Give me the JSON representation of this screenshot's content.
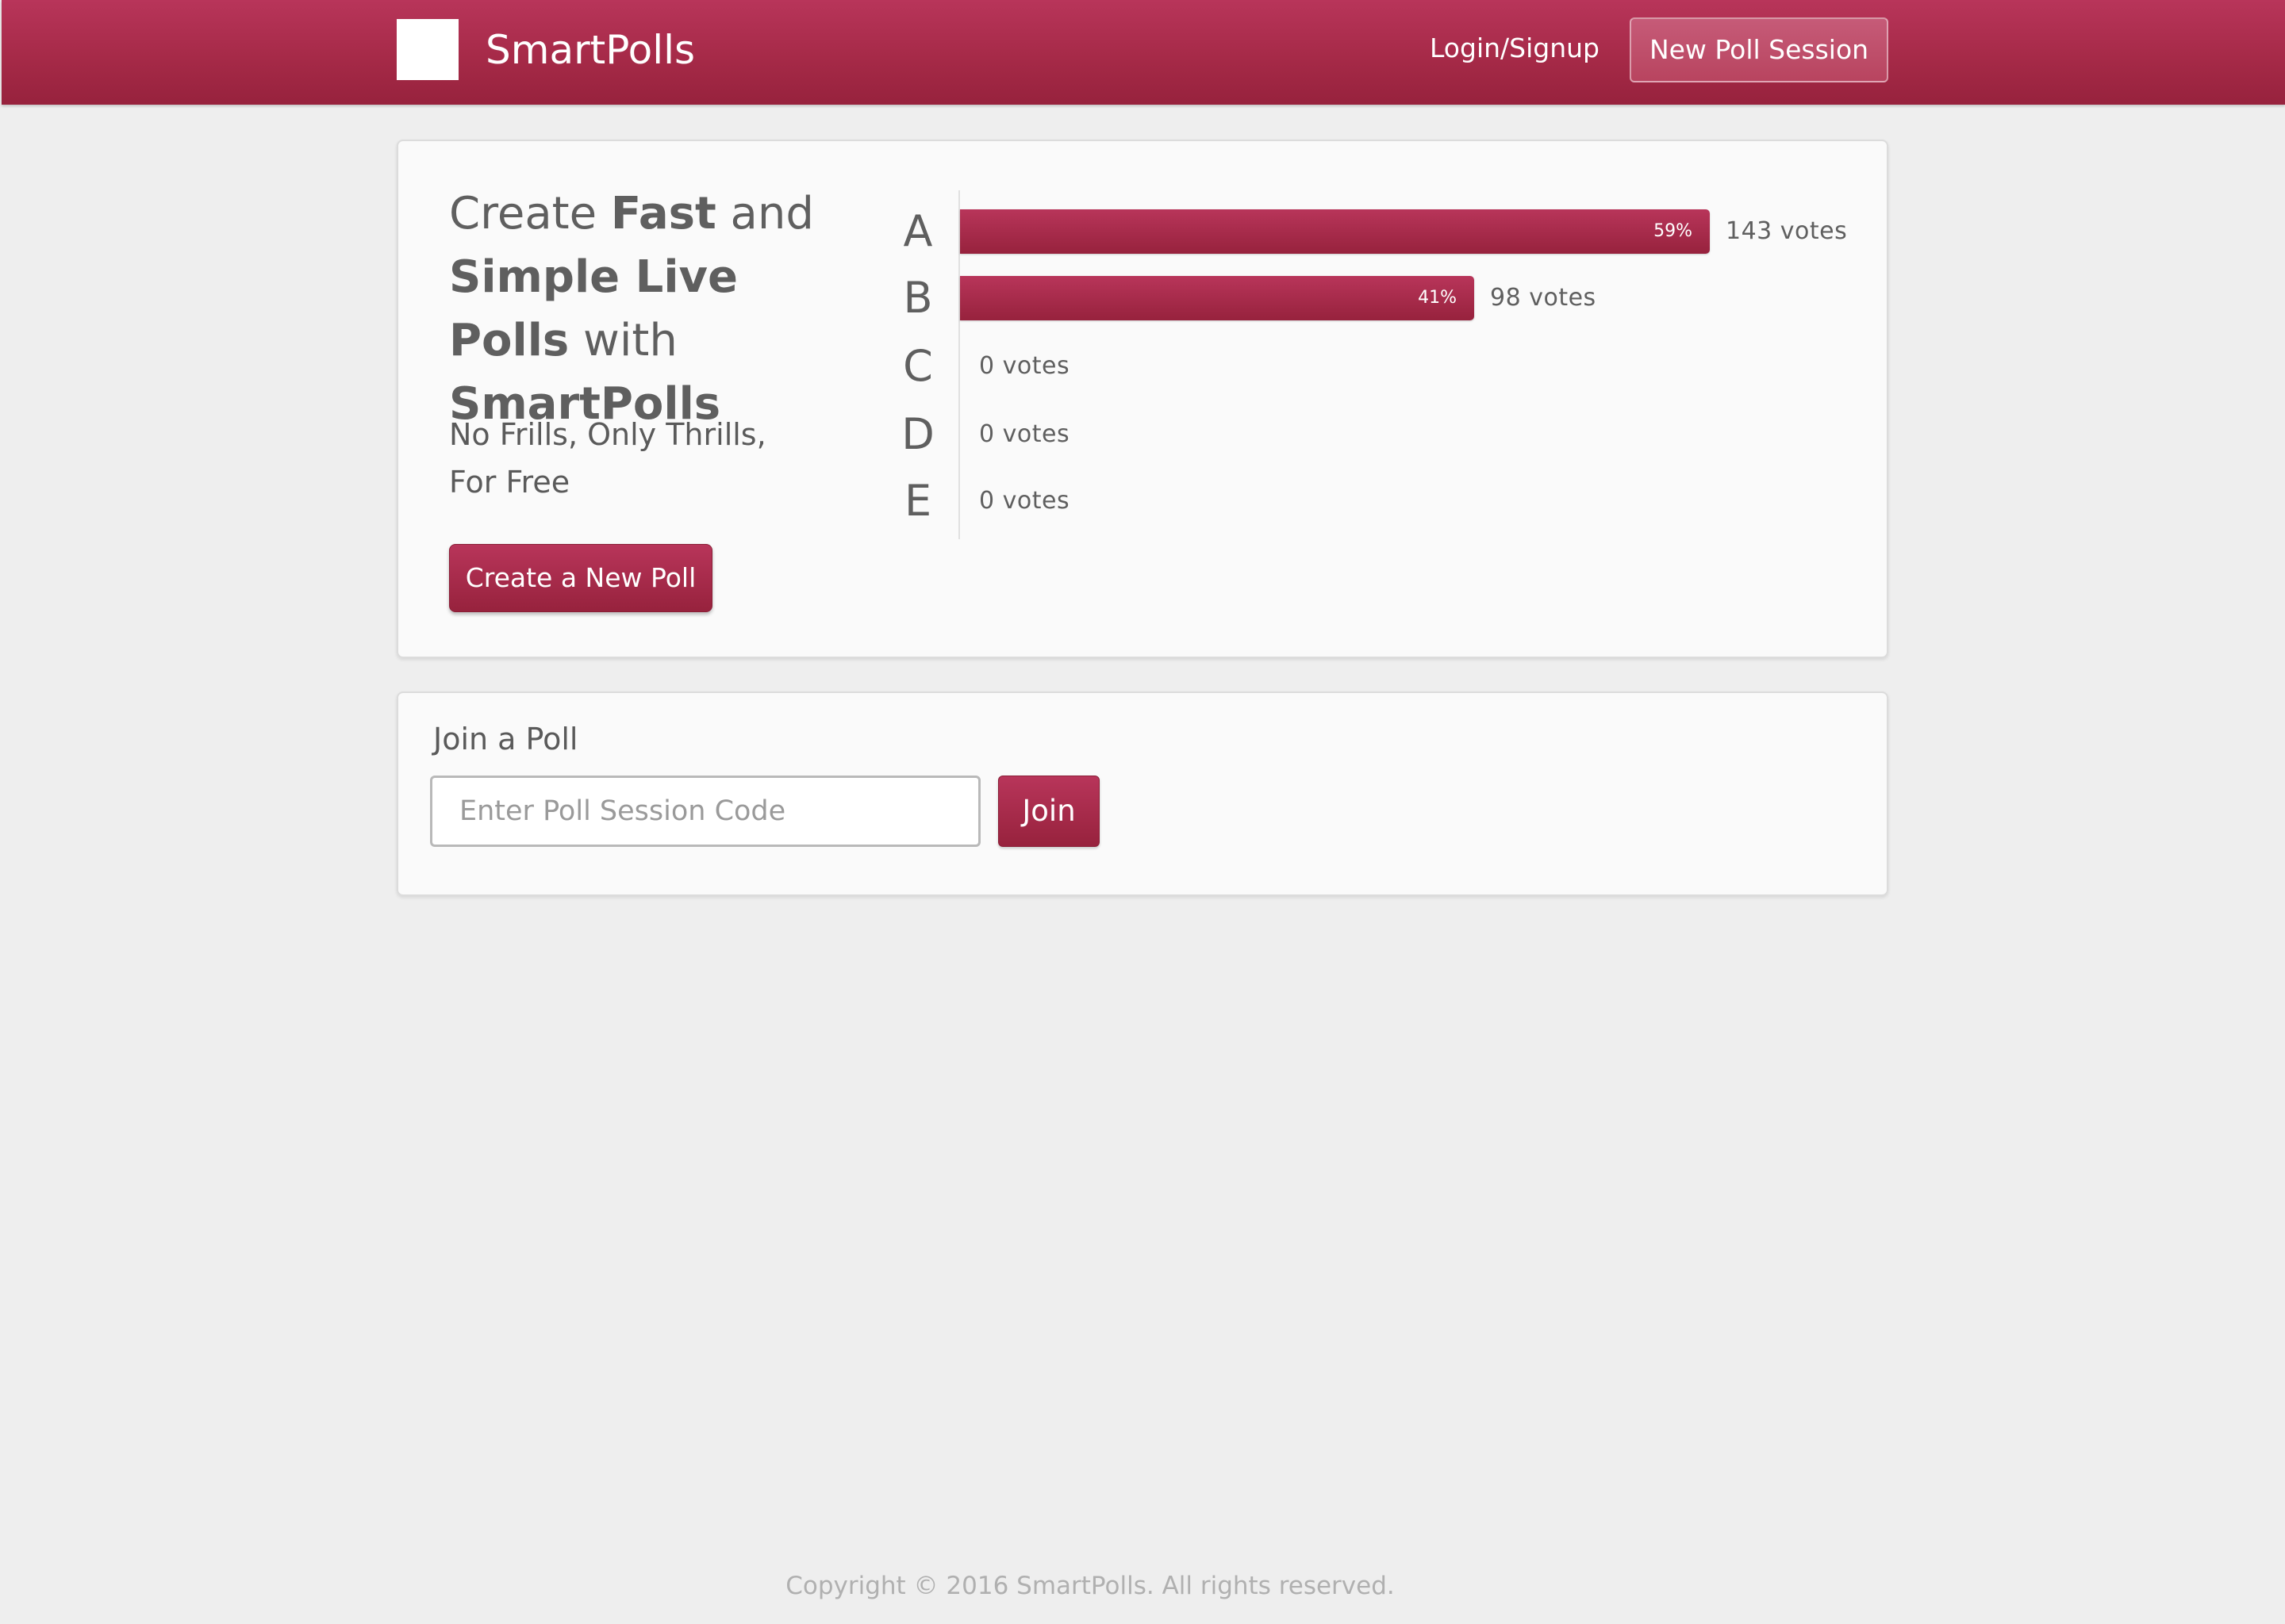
{
  "header": {
    "brand_name": "SmartPolls",
    "login_label": "Login/Signup",
    "new_session_label": "New Poll Session"
  },
  "hero": {
    "headline": {
      "w1": "Create ",
      "w2": "Fast",
      "w3": " and ",
      "w4": "Simple Live Polls",
      "w5": " with ",
      "w6": "SmartPolls"
    },
    "tagline_line1": "No Frills, Only Thrills,",
    "tagline_line2": "For Free",
    "create_button_label": "Create a New Poll"
  },
  "chart_data": {
    "type": "bar",
    "orientation": "horizontal",
    "categories": [
      "A",
      "B",
      "C",
      "D",
      "E"
    ],
    "values": [
      143,
      98,
      0,
      0,
      0
    ],
    "percent_labels": [
      "59%",
      "41%",
      "",
      "",
      ""
    ],
    "vote_labels": [
      "143 votes",
      "98 votes",
      "0 votes",
      "0 votes",
      "0 votes"
    ],
    "bar_color": "#a62a48"
  },
  "join": {
    "title": "Join a Poll",
    "input_placeholder": "Enter Poll Session Code",
    "input_value": "",
    "button_label": "Join"
  },
  "footer": {
    "copyright": "Copyright © 2016 SmartPolls. All rights reserved."
  },
  "colors": {
    "brand": "#a62a48",
    "page_background": "#eeeeee",
    "panel_background": "#fafafa"
  }
}
